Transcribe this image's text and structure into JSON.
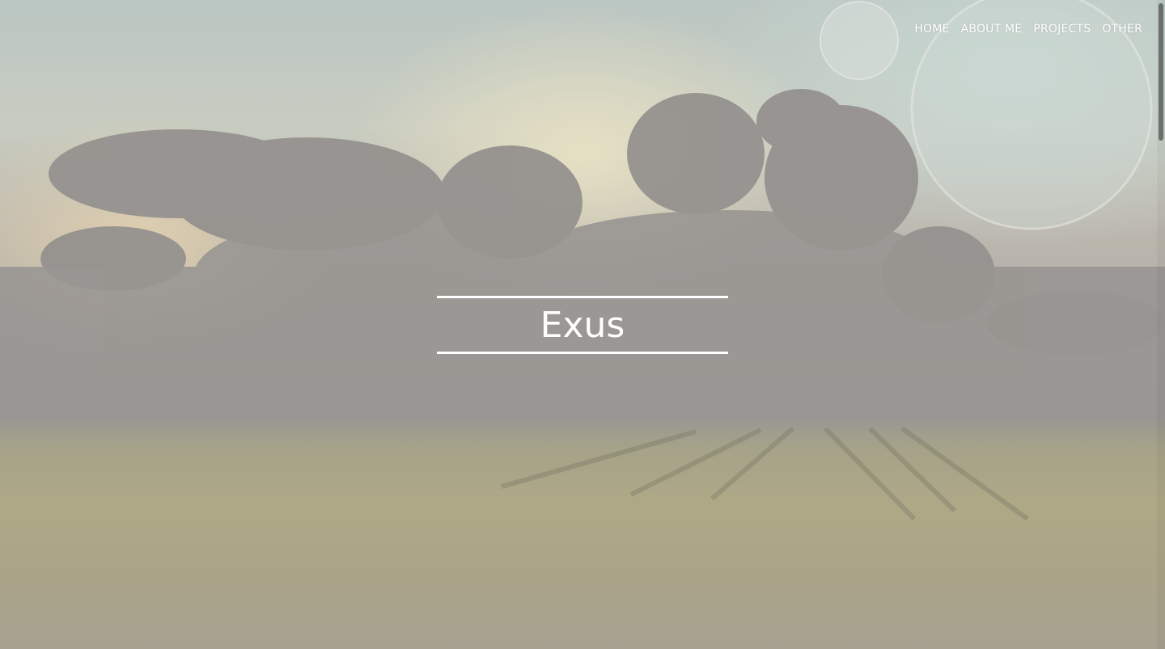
{
  "nav": {
    "items": [
      {
        "label": "HOME"
      },
      {
        "label": "ABOUT ME"
      },
      {
        "label": "PROJECTS"
      },
      {
        "label": "OTHER"
      }
    ]
  },
  "hero": {
    "title": "Exus"
  },
  "colors": {
    "text": "#ffffff",
    "rule": "#ffffff"
  },
  "background": {
    "description_icon": "landscape-clouds-field-planets-image"
  }
}
